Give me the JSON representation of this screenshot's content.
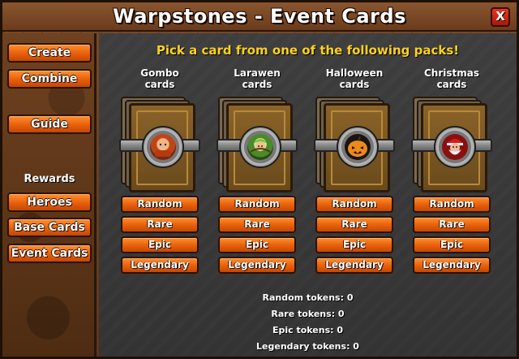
{
  "window": {
    "title": "Warpstones - Event Cards",
    "close_label": "X"
  },
  "sidebar": {
    "create_label": "Create",
    "combine_label": "Combine",
    "guide_label": "Guide",
    "rewards_label": "Rewards",
    "heroes_label": "Heroes",
    "base_cards_label": "Base Cards",
    "event_cards_label": "Event Cards"
  },
  "main": {
    "instruction": "Pick a card from one of the following packs!",
    "packs": [
      {
        "name_line1": "Gombo",
        "name_line2": "cards",
        "icon": "warrior-hero-icon"
      },
      {
        "name_line1": "Larawen",
        "name_line2": "cards",
        "icon": "archer-hero-icon"
      },
      {
        "name_line1": "Halloween",
        "name_line2": "cards",
        "icon": "pumpkin-icon"
      },
      {
        "name_line1": "Christmas",
        "name_line2": "cards",
        "icon": "santa-icon"
      }
    ],
    "buttons": {
      "random": "Random",
      "rare": "Rare",
      "epic": "Epic",
      "legendary": "Legendary"
    },
    "tokens": {
      "random": "Random tokens: 0",
      "rare": "Rare tokens: 0",
      "epic": "Epic tokens: 0",
      "legendary": "Legendary tokens: 0"
    }
  },
  "colors": {
    "accent_orange": "#e85f0a",
    "instruction_yellow": "#ffd21f",
    "close_red": "#d02a14",
    "panel_gray": "#3a3a3a",
    "frame_brown": "#6a3c1c"
  }
}
